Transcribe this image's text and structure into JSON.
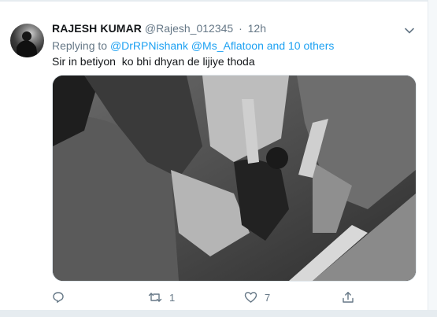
{
  "tweet": {
    "author_name": "RAJESH KUMAR",
    "author_handle": "@Rajesh_012345",
    "separator": "·",
    "time": "12h",
    "replying_prefix": "Replying to",
    "replying_mentions": "@DrRPNishank @Ms_Aflatoon and 10 others",
    "text": "Sir in betiyon  ko bhi dhyan de lijiye thoda",
    "photo_icon": "photo-black-and-white",
    "actions": {
      "reply": {
        "icon": "reply-icon",
        "count": ""
      },
      "retweet": {
        "icon": "retweet-icon",
        "count": "1"
      },
      "like": {
        "icon": "like-icon",
        "count": "7"
      },
      "share": {
        "icon": "share-icon",
        "count": ""
      }
    }
  },
  "colors": {
    "accent": "#1da1f2",
    "secondary_text": "#657786",
    "primary_text": "#14171a",
    "border": "#e6ecf0"
  }
}
